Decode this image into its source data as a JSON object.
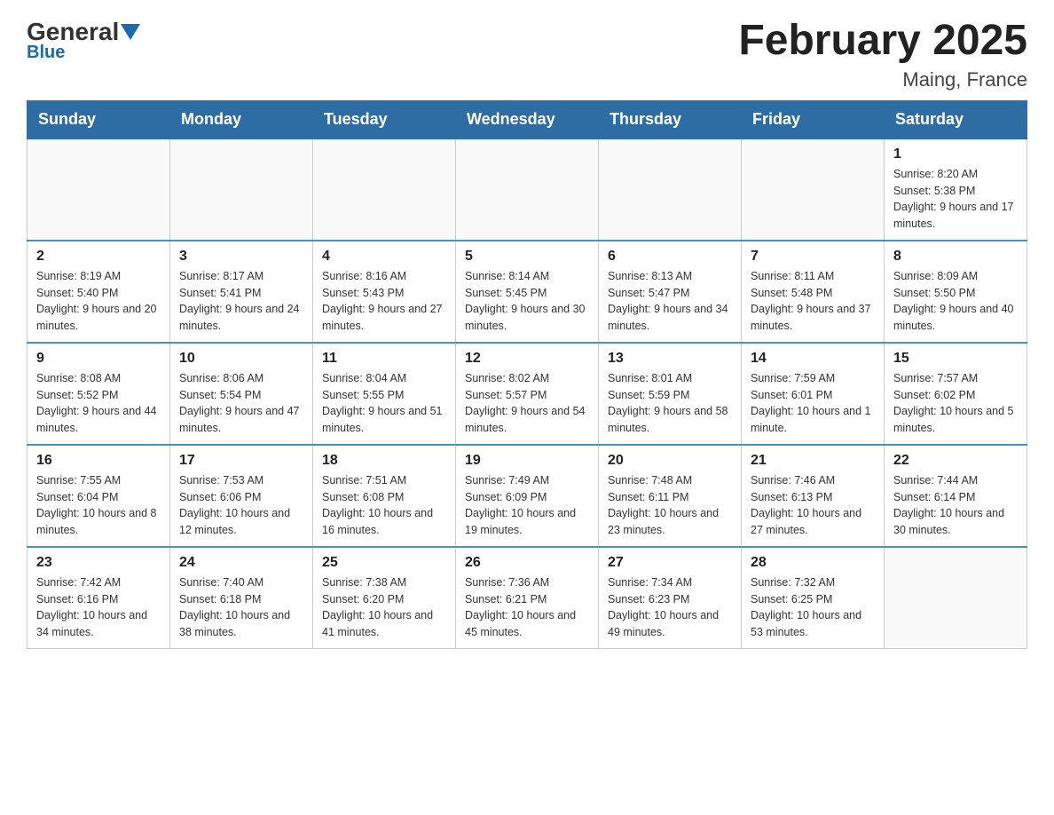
{
  "header": {
    "logo_general": "General",
    "logo_blue": "Blue",
    "title": "February 2025",
    "subtitle": "Maing, France"
  },
  "weekdays": [
    "Sunday",
    "Monday",
    "Tuesday",
    "Wednesday",
    "Thursday",
    "Friday",
    "Saturday"
  ],
  "weeks": [
    [
      {
        "day": "",
        "info": ""
      },
      {
        "day": "",
        "info": ""
      },
      {
        "day": "",
        "info": ""
      },
      {
        "day": "",
        "info": ""
      },
      {
        "day": "",
        "info": ""
      },
      {
        "day": "",
        "info": ""
      },
      {
        "day": "1",
        "info": "Sunrise: 8:20 AM\nSunset: 5:38 PM\nDaylight: 9 hours and 17 minutes."
      }
    ],
    [
      {
        "day": "2",
        "info": "Sunrise: 8:19 AM\nSunset: 5:40 PM\nDaylight: 9 hours and 20 minutes."
      },
      {
        "day": "3",
        "info": "Sunrise: 8:17 AM\nSunset: 5:41 PM\nDaylight: 9 hours and 24 minutes."
      },
      {
        "day": "4",
        "info": "Sunrise: 8:16 AM\nSunset: 5:43 PM\nDaylight: 9 hours and 27 minutes."
      },
      {
        "day": "5",
        "info": "Sunrise: 8:14 AM\nSunset: 5:45 PM\nDaylight: 9 hours and 30 minutes."
      },
      {
        "day": "6",
        "info": "Sunrise: 8:13 AM\nSunset: 5:47 PM\nDaylight: 9 hours and 34 minutes."
      },
      {
        "day": "7",
        "info": "Sunrise: 8:11 AM\nSunset: 5:48 PM\nDaylight: 9 hours and 37 minutes."
      },
      {
        "day": "8",
        "info": "Sunrise: 8:09 AM\nSunset: 5:50 PM\nDaylight: 9 hours and 40 minutes."
      }
    ],
    [
      {
        "day": "9",
        "info": "Sunrise: 8:08 AM\nSunset: 5:52 PM\nDaylight: 9 hours and 44 minutes."
      },
      {
        "day": "10",
        "info": "Sunrise: 8:06 AM\nSunset: 5:54 PM\nDaylight: 9 hours and 47 minutes."
      },
      {
        "day": "11",
        "info": "Sunrise: 8:04 AM\nSunset: 5:55 PM\nDaylight: 9 hours and 51 minutes."
      },
      {
        "day": "12",
        "info": "Sunrise: 8:02 AM\nSunset: 5:57 PM\nDaylight: 9 hours and 54 minutes."
      },
      {
        "day": "13",
        "info": "Sunrise: 8:01 AM\nSunset: 5:59 PM\nDaylight: 9 hours and 58 minutes."
      },
      {
        "day": "14",
        "info": "Sunrise: 7:59 AM\nSunset: 6:01 PM\nDaylight: 10 hours and 1 minute."
      },
      {
        "day": "15",
        "info": "Sunrise: 7:57 AM\nSunset: 6:02 PM\nDaylight: 10 hours and 5 minutes."
      }
    ],
    [
      {
        "day": "16",
        "info": "Sunrise: 7:55 AM\nSunset: 6:04 PM\nDaylight: 10 hours and 8 minutes."
      },
      {
        "day": "17",
        "info": "Sunrise: 7:53 AM\nSunset: 6:06 PM\nDaylight: 10 hours and 12 minutes."
      },
      {
        "day": "18",
        "info": "Sunrise: 7:51 AM\nSunset: 6:08 PM\nDaylight: 10 hours and 16 minutes."
      },
      {
        "day": "19",
        "info": "Sunrise: 7:49 AM\nSunset: 6:09 PM\nDaylight: 10 hours and 19 minutes."
      },
      {
        "day": "20",
        "info": "Sunrise: 7:48 AM\nSunset: 6:11 PM\nDaylight: 10 hours and 23 minutes."
      },
      {
        "day": "21",
        "info": "Sunrise: 7:46 AM\nSunset: 6:13 PM\nDaylight: 10 hours and 27 minutes."
      },
      {
        "day": "22",
        "info": "Sunrise: 7:44 AM\nSunset: 6:14 PM\nDaylight: 10 hours and 30 minutes."
      }
    ],
    [
      {
        "day": "23",
        "info": "Sunrise: 7:42 AM\nSunset: 6:16 PM\nDaylight: 10 hours and 34 minutes."
      },
      {
        "day": "24",
        "info": "Sunrise: 7:40 AM\nSunset: 6:18 PM\nDaylight: 10 hours and 38 minutes."
      },
      {
        "day": "25",
        "info": "Sunrise: 7:38 AM\nSunset: 6:20 PM\nDaylight: 10 hours and 41 minutes."
      },
      {
        "day": "26",
        "info": "Sunrise: 7:36 AM\nSunset: 6:21 PM\nDaylight: 10 hours and 45 minutes."
      },
      {
        "day": "27",
        "info": "Sunrise: 7:34 AM\nSunset: 6:23 PM\nDaylight: 10 hours and 49 minutes."
      },
      {
        "day": "28",
        "info": "Sunrise: 7:32 AM\nSunset: 6:25 PM\nDaylight: 10 hours and 53 minutes."
      },
      {
        "day": "",
        "info": ""
      }
    ]
  ]
}
